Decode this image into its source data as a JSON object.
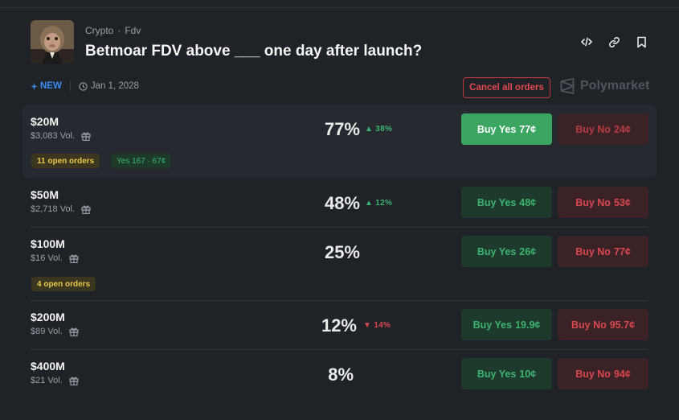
{
  "header": {
    "category": "Crypto",
    "subcategory": "Fdv",
    "breadcrumb_sep": "·",
    "title": "Betmoar FDV above ___ one day after launch?",
    "icons": [
      "code-icon",
      "link-icon",
      "bookmark-icon"
    ]
  },
  "meta": {
    "new_label": "NEW",
    "date": "Jan 1, 2028",
    "cancel_label": "Cancel all orders",
    "brand": "Polymarket"
  },
  "colors": {
    "green": "#3cb371",
    "red": "#d9474f",
    "blue": "#3b8cf2",
    "yellow": "#e9c84a"
  },
  "markets": [
    {
      "label": "$20M",
      "volume": "$3,083 Vol.",
      "percent": "77%",
      "change": "38%",
      "change_dir": "up",
      "yes_text": "Buy Yes",
      "yes_price": "77¢",
      "no_text": "Buy No",
      "no_price": "24¢",
      "orders_tag": "11 open orders",
      "position_tag": "Yes 167 · 67¢"
    },
    {
      "label": "$50M",
      "volume": "$2,718 Vol.",
      "percent": "48%",
      "change": "12%",
      "change_dir": "up",
      "yes_text": "Buy Yes",
      "yes_price": "48¢",
      "no_text": "Buy No",
      "no_price": "53¢"
    },
    {
      "label": "$100M",
      "volume": "$16 Vol.",
      "percent": "25%",
      "yes_text": "Buy Yes",
      "yes_price": "26¢",
      "no_text": "Buy No",
      "no_price": "77¢",
      "orders_tag": "4 open orders"
    },
    {
      "label": "$200M",
      "volume": "$89 Vol.",
      "percent": "12%",
      "change": "14%",
      "change_dir": "down",
      "yes_text": "Buy Yes",
      "yes_price": "19.9¢",
      "no_text": "Buy No",
      "no_price": "95.7¢"
    },
    {
      "label": "$400M",
      "volume": "$21 Vol.",
      "percent": "8%",
      "yes_text": "Buy Yes",
      "yes_price": "10¢",
      "no_text": "Buy No",
      "no_price": "94¢"
    }
  ]
}
